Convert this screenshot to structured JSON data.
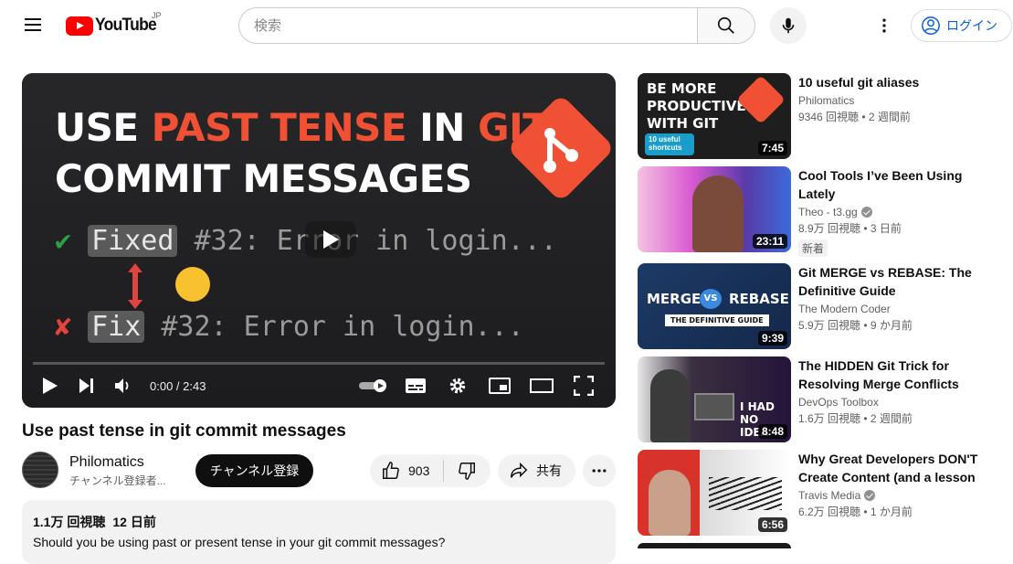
{
  "header": {
    "logo_text": "YouTube",
    "region": "JP",
    "search_placeholder": "検索",
    "login_label": "ログイン"
  },
  "player": {
    "thumbnail_text": {
      "line1_a": "USE ",
      "line1_b": "PAST TENSE",
      "line1_c": " IN ",
      "line1_d": "GIT",
      "line2": "COMMIT MESSAGES",
      "good_tag": "Fixed",
      "good_rest": " #32: Error in login...",
      "bad_tag": "Fix",
      "bad_rest": " #32: Error in login..."
    },
    "time_current": "0:00",
    "time_separator": " / ",
    "time_total": "2:43",
    "progress": 0
  },
  "video": {
    "title": "Use past tense in git commit messages",
    "channel": "Philomatics",
    "subscribers": "チャンネル登録者...",
    "subscribe_label": "チャンネル登録",
    "likes": "903",
    "share_label": "共有",
    "views": "1.1万 回視聴",
    "date": "12 日前",
    "description": "Should you be using past or present tense in your git commit messages?"
  },
  "recommendations": [
    {
      "title": "10 useful git aliases",
      "channel": "Philomatics",
      "stats": "9346 回視聴 • 2 週間前",
      "duration": "7:45",
      "thumb_text": "BE MORE PRODUCTIVE WITH GIT",
      "thumb_sub": "10 useful shortcuts",
      "verified": false,
      "new": ""
    },
    {
      "title": "Cool Tools I’ve Been Using Lately",
      "channel": "Theo - t3.gg",
      "stats": "8.9万 回視聴 • 3 日前",
      "duration": "23:11",
      "verified": true,
      "new": "新着"
    },
    {
      "title": "Git MERGE vs REBASE: The Definitive Guide",
      "channel": "The Modern Coder",
      "stats": "5.9万 回視聴 • 9 か月前",
      "duration": "9:39",
      "thumb_left": "MERGE",
      "thumb_vs": "VS",
      "thumb_right": "REBASE",
      "thumb_sub": "THE DEFINITIVE GUIDE",
      "verified": false,
      "new": ""
    },
    {
      "title": "The HIDDEN Git Trick for Resolving Merge Conflicts",
      "channel": "DevOps Toolbox",
      "stats": "1.6万 回視聴 • 2 週間前",
      "duration": "8:48",
      "thumb_text": "I HAD NO IDEA",
      "verified": false,
      "new": ""
    },
    {
      "title": "Why Great Developers DON'T Create Content (and a lesson t...",
      "channel": "Travis Media",
      "stats": "6.2万 回視聴 • 1 か月前",
      "duration": "6:56",
      "verified": true,
      "new": ""
    }
  ],
  "colors": {
    "brand_red": "#ff0000",
    "git_orange": "#f05033",
    "link_blue": "#065fd4"
  }
}
